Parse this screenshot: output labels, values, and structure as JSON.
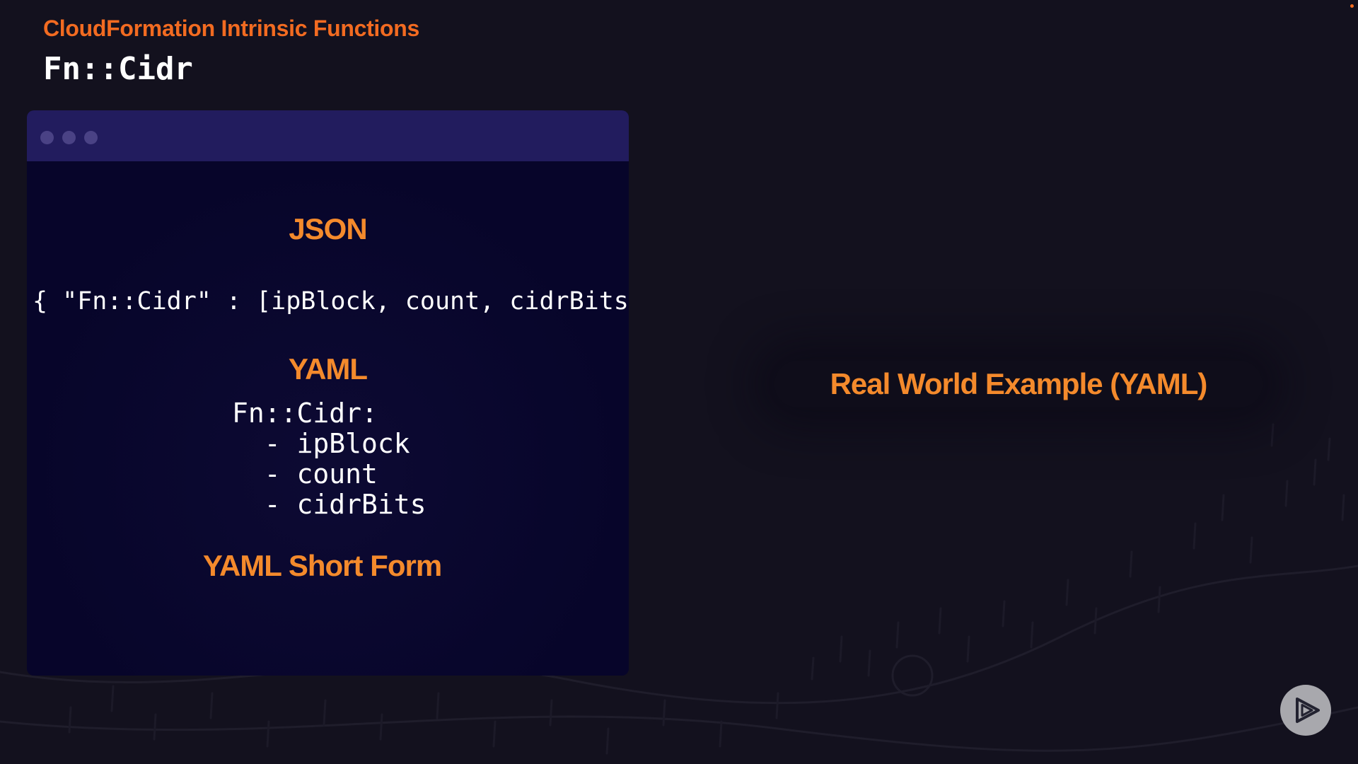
{
  "header": {
    "kicker": "CloudFormation Intrinsic Functions",
    "title": "Fn::Cidr"
  },
  "code_window": {
    "json_heading": "JSON",
    "json_code": "{ \"Fn::Cidr\" : [ipBlock, count, cidrBits]}",
    "yaml_heading": "YAML",
    "yaml_code": "Fn::Cidr:\n  - ipBlock\n  - count\n  - cidrBits",
    "yaml_short_heading": "YAML Short Form"
  },
  "right_panel": {
    "label": "Real World Example (YAML)"
  },
  "controls": {
    "play_icon": "play-icon"
  },
  "colors": {
    "accent": "#f48a2c",
    "kicker": "#f26b21",
    "background": "#13111e",
    "window_bar": "#221c5e",
    "window_body": "#08062a"
  }
}
